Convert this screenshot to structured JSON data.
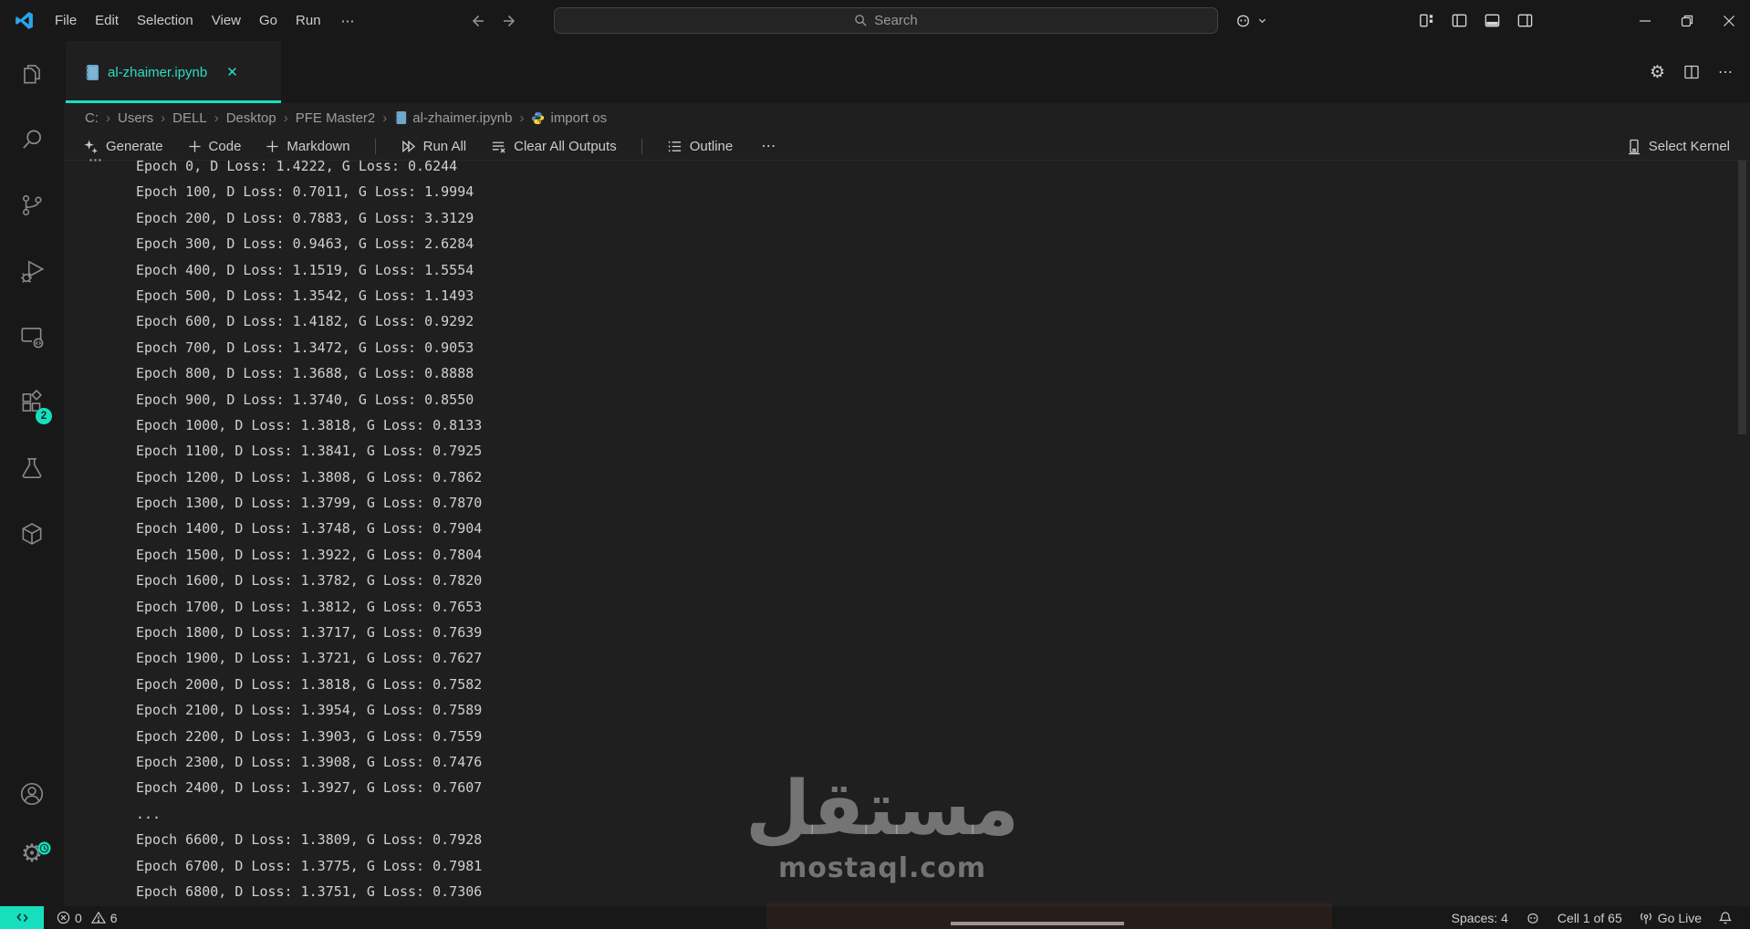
{
  "colors": {
    "accent": "#16dfbd",
    "tab_text": "#2edcbf",
    "titlebar_bg": "#181818",
    "editor_bg": "#1f1f1f",
    "text": "#cccccc"
  },
  "titlebar": {
    "menus": [
      "File",
      "Edit",
      "Selection",
      "View",
      "Go",
      "Run"
    ],
    "menu_more": "⋯",
    "search_placeholder": "Search"
  },
  "tab": {
    "label": "al-zhaimer.ipynb",
    "close": "✕"
  },
  "breadcrumb": {
    "separator": "›",
    "items": [
      "C:",
      "Users",
      "DELL",
      "Desktop",
      "PFE Master2",
      "al-zhaimer.ipynb",
      "import os"
    ]
  },
  "notebook_toolbar": {
    "generate": "Generate",
    "code": "Code",
    "markdown": "Markdown",
    "run_all": "Run All",
    "clear_all_outputs": "Clear All Outputs",
    "outline": "Outline",
    "more": "⋯",
    "select_kernel": "Select Kernel"
  },
  "cell_output": {
    "actions_more": "⋯",
    "lines": [
      "Epoch 0, D Loss: 1.4222, G Loss: 0.6244",
      "Epoch 100, D Loss: 0.7011, G Loss: 1.9994",
      "Epoch 200, D Loss: 0.7883, G Loss: 3.3129",
      "Epoch 300, D Loss: 0.9463, G Loss: 2.6284",
      "Epoch 400, D Loss: 1.1519, G Loss: 1.5554",
      "Epoch 500, D Loss: 1.3542, G Loss: 1.1493",
      "Epoch 600, D Loss: 1.4182, G Loss: 0.9292",
      "Epoch 700, D Loss: 1.3472, G Loss: 0.9053",
      "Epoch 800, D Loss: 1.3688, G Loss: 0.8888",
      "Epoch 900, D Loss: 1.3740, G Loss: 0.8550",
      "Epoch 1000, D Loss: 1.3818, G Loss: 0.8133",
      "Epoch 1100, D Loss: 1.3841, G Loss: 0.7925",
      "Epoch 1200, D Loss: 1.3808, G Loss: 0.7862",
      "Epoch 1300, D Loss: 1.3799, G Loss: 0.7870",
      "Epoch 1400, D Loss: 1.3748, G Loss: 0.7904",
      "Epoch 1500, D Loss: 1.3922, G Loss: 0.7804",
      "Epoch 1600, D Loss: 1.3782, G Loss: 0.7820",
      "Epoch 1700, D Loss: 1.3812, G Loss: 0.7653",
      "Epoch 1800, D Loss: 1.3717, G Loss: 0.7639",
      "Epoch 1900, D Loss: 1.3721, G Loss: 0.7627",
      "Epoch 2000, D Loss: 1.3818, G Loss: 0.7582",
      "Epoch 2100, D Loss: 1.3954, G Loss: 0.7589",
      "Epoch 2200, D Loss: 1.3903, G Loss: 0.7559",
      "Epoch 2300, D Loss: 1.3908, G Loss: 0.7476",
      "Epoch 2400, D Loss: 1.3927, G Loss: 0.7607",
      "...",
      "Epoch 6600, D Loss: 1.3809, G Loss: 0.7928",
      "Epoch 6700, D Loss: 1.3775, G Loss: 0.7981",
      "Epoch 6800, D Loss: 1.3751, G Loss: 0.7306"
    ]
  },
  "status_bar": {
    "errors": "0",
    "warnings": "6",
    "spaces": "Spaces: 4",
    "cell_position": "Cell 1 of 65",
    "go_live": "Go Live"
  },
  "activity_bar": {
    "extensions_badge": "2"
  },
  "watermark": {
    "arabic": "مستقل",
    "latin": "mostaql.com"
  }
}
